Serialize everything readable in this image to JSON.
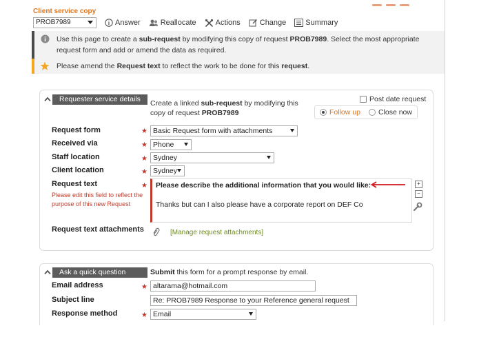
{
  "page": {
    "title": "Client service copy"
  },
  "toolbar": {
    "request_select": "PROB7989",
    "answer": "Answer",
    "reallocate": "Reallocate",
    "actions": "Actions",
    "change": "Change",
    "summary": "Summary"
  },
  "notices": {
    "info_prefix": "Use this page to create a ",
    "info_bold1": "sub-request",
    "info_mid": " by modifying this copy of request ",
    "info_bold2": "PROB7989",
    "info_suffix": ". Select the most appropriate request form and add or amend the data as required.",
    "amend_prefix": "Please amend the ",
    "amend_bold1": "Request text",
    "amend_mid": " to reflect the work to be done for this ",
    "amend_bold2": "request",
    "amend_suffix": "."
  },
  "requester": {
    "header": "Requester service details",
    "linked_prefix": "Create a linked ",
    "linked_bold": "sub-request",
    "linked_mid": " by modifying this copy of request ",
    "linked_bold2": "PROB7989",
    "post_date": "Post date request",
    "follow_up": "Follow up",
    "close_now": "Close now",
    "fields": {
      "request_form_label": "Request form",
      "request_form_value": "Basic Request form with attachments",
      "received_via_label": "Received via",
      "received_via_value": "Phone",
      "staff_location_label": "Staff location",
      "staff_location_value": "Sydney",
      "client_location_label": "Client location",
      "client_location_value": "Sydney",
      "request_text_label": "Request text",
      "request_text_hint": "Please edit this field to reflect the purpose of this new Request",
      "request_text_prompt": "Please describe the additional information that you would like:",
      "request_text_body": "Thanks but can I also please have a corporate report on DEF Co",
      "attachments_label": "Request text attachments",
      "attachments_link": "[Manage request attachments]"
    }
  },
  "quick": {
    "header": "Ask a quick question",
    "desc_bold": "Submit",
    "desc_rest": " this form for a prompt response by email.",
    "email_label": "Email address",
    "email_value": "altarama@hotmail.com",
    "subject_label": "Subject line",
    "subject_value": "Re: PROB7989 Response to your Reference general  request",
    "method_label": "Response method",
    "method_value": "Email"
  },
  "colors": {
    "accent": "#e0751c",
    "required": "#c0392b",
    "header_bg": "#5c5c5c",
    "link": "#6d8a1f"
  }
}
